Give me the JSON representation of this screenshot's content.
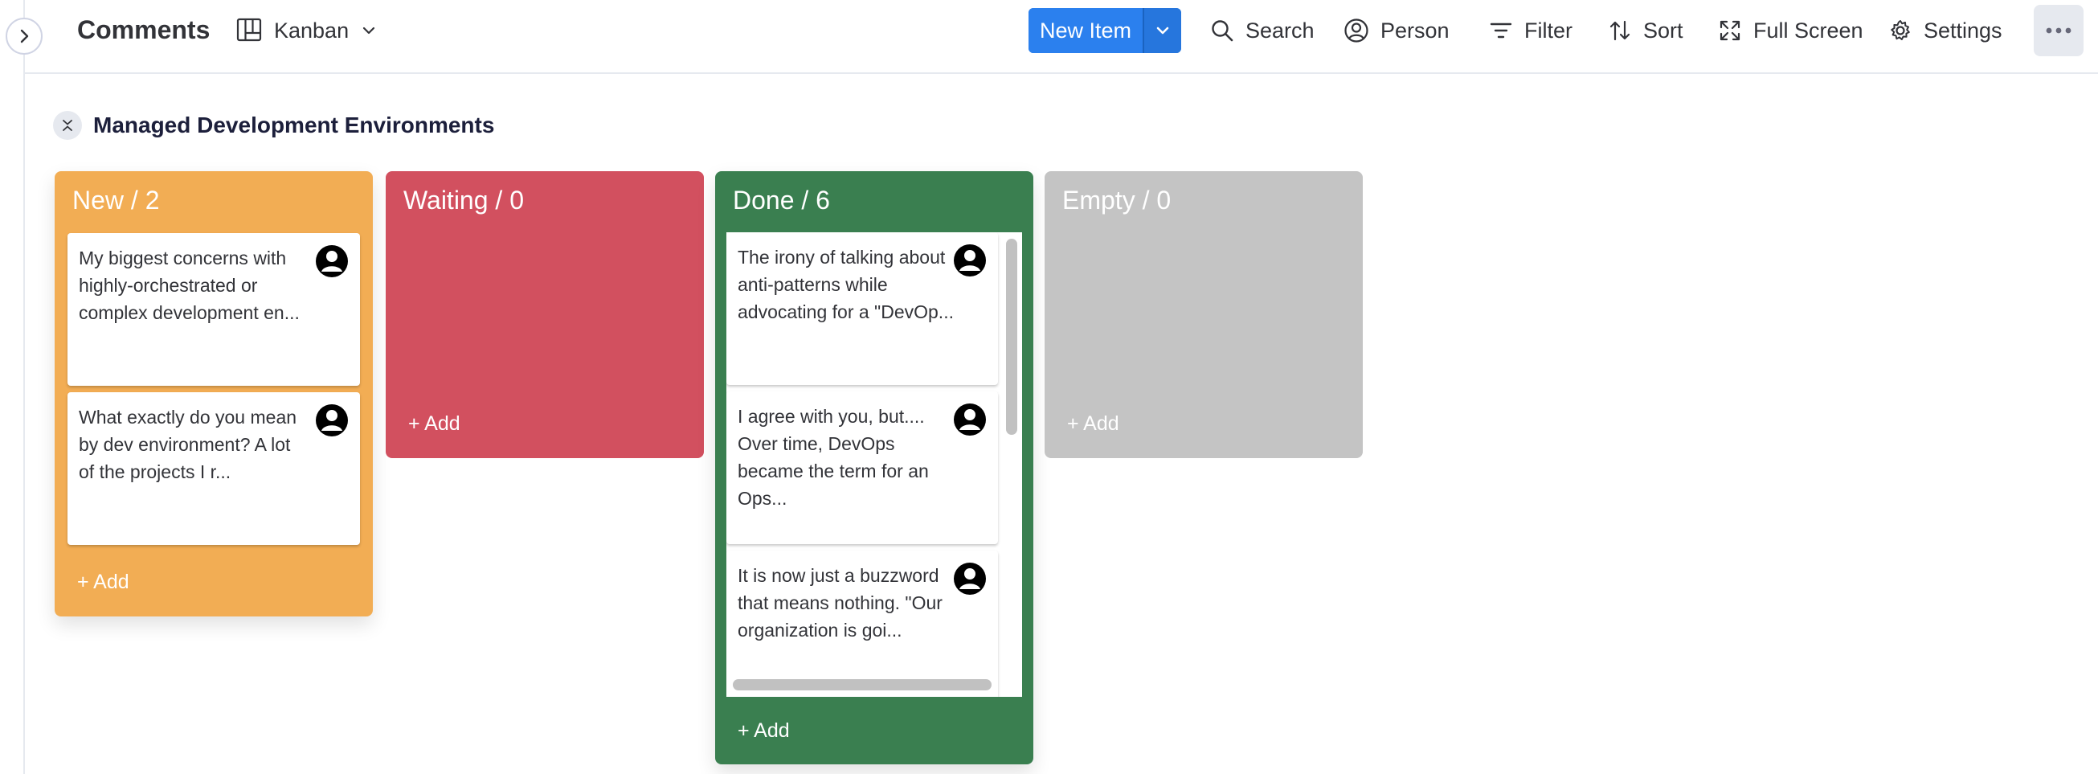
{
  "board": {
    "title": "Comments"
  },
  "view": {
    "label": "Kanban"
  },
  "toolbar": {
    "new_item": "New Item",
    "search": "Search",
    "person": "Person",
    "filter": "Filter",
    "sort": "Sort",
    "fullscreen": "Full Screen",
    "settings": "Settings"
  },
  "group": {
    "title": "Managed Development Environments"
  },
  "columns": [
    {
      "title": "New / 2",
      "color": "#f2ad54",
      "add_label": "+ Add",
      "cards": [
        {
          "text": "My biggest concerns with highly-orchestrated or complex development en..."
        },
        {
          "text": "What exactly do you mean by dev environment? A lot of the projects I r..."
        }
      ]
    },
    {
      "title": "Waiting / 0",
      "color": "#d2505f",
      "add_label": "+ Add",
      "cards": []
    },
    {
      "title": "Done / 6",
      "color": "#3a7f50",
      "add_label": "+ Add",
      "cards": [
        {
          "text": "The irony of talking about anti-patterns while advocating for a \"DevOp..."
        },
        {
          "text": "I agree with you, but.... Over time, DevOps became the term for an Ops..."
        },
        {
          "text": "It is now just a buzzword that means nothing. \"Our organization is goi..."
        }
      ]
    },
    {
      "title": "Empty / 0",
      "color": "#c4c4c4",
      "add_label": "+ Add",
      "cards": []
    }
  ],
  "icons": {
    "rail_toggle": "chevron-right-icon",
    "view": "kanban-icon",
    "view_dropdown": "chevron-down-icon",
    "new_item_dropdown": "chevron-down-icon",
    "search": "search-icon",
    "person": "person-circle-icon",
    "filter": "filter-icon",
    "sort": "sort-icon",
    "fullscreen": "fullscreen-icon",
    "settings": "gear-icon",
    "more": "more-horizontal-icon",
    "collapse": "collapse-icon",
    "card_avatar": "user-avatar-icon"
  }
}
